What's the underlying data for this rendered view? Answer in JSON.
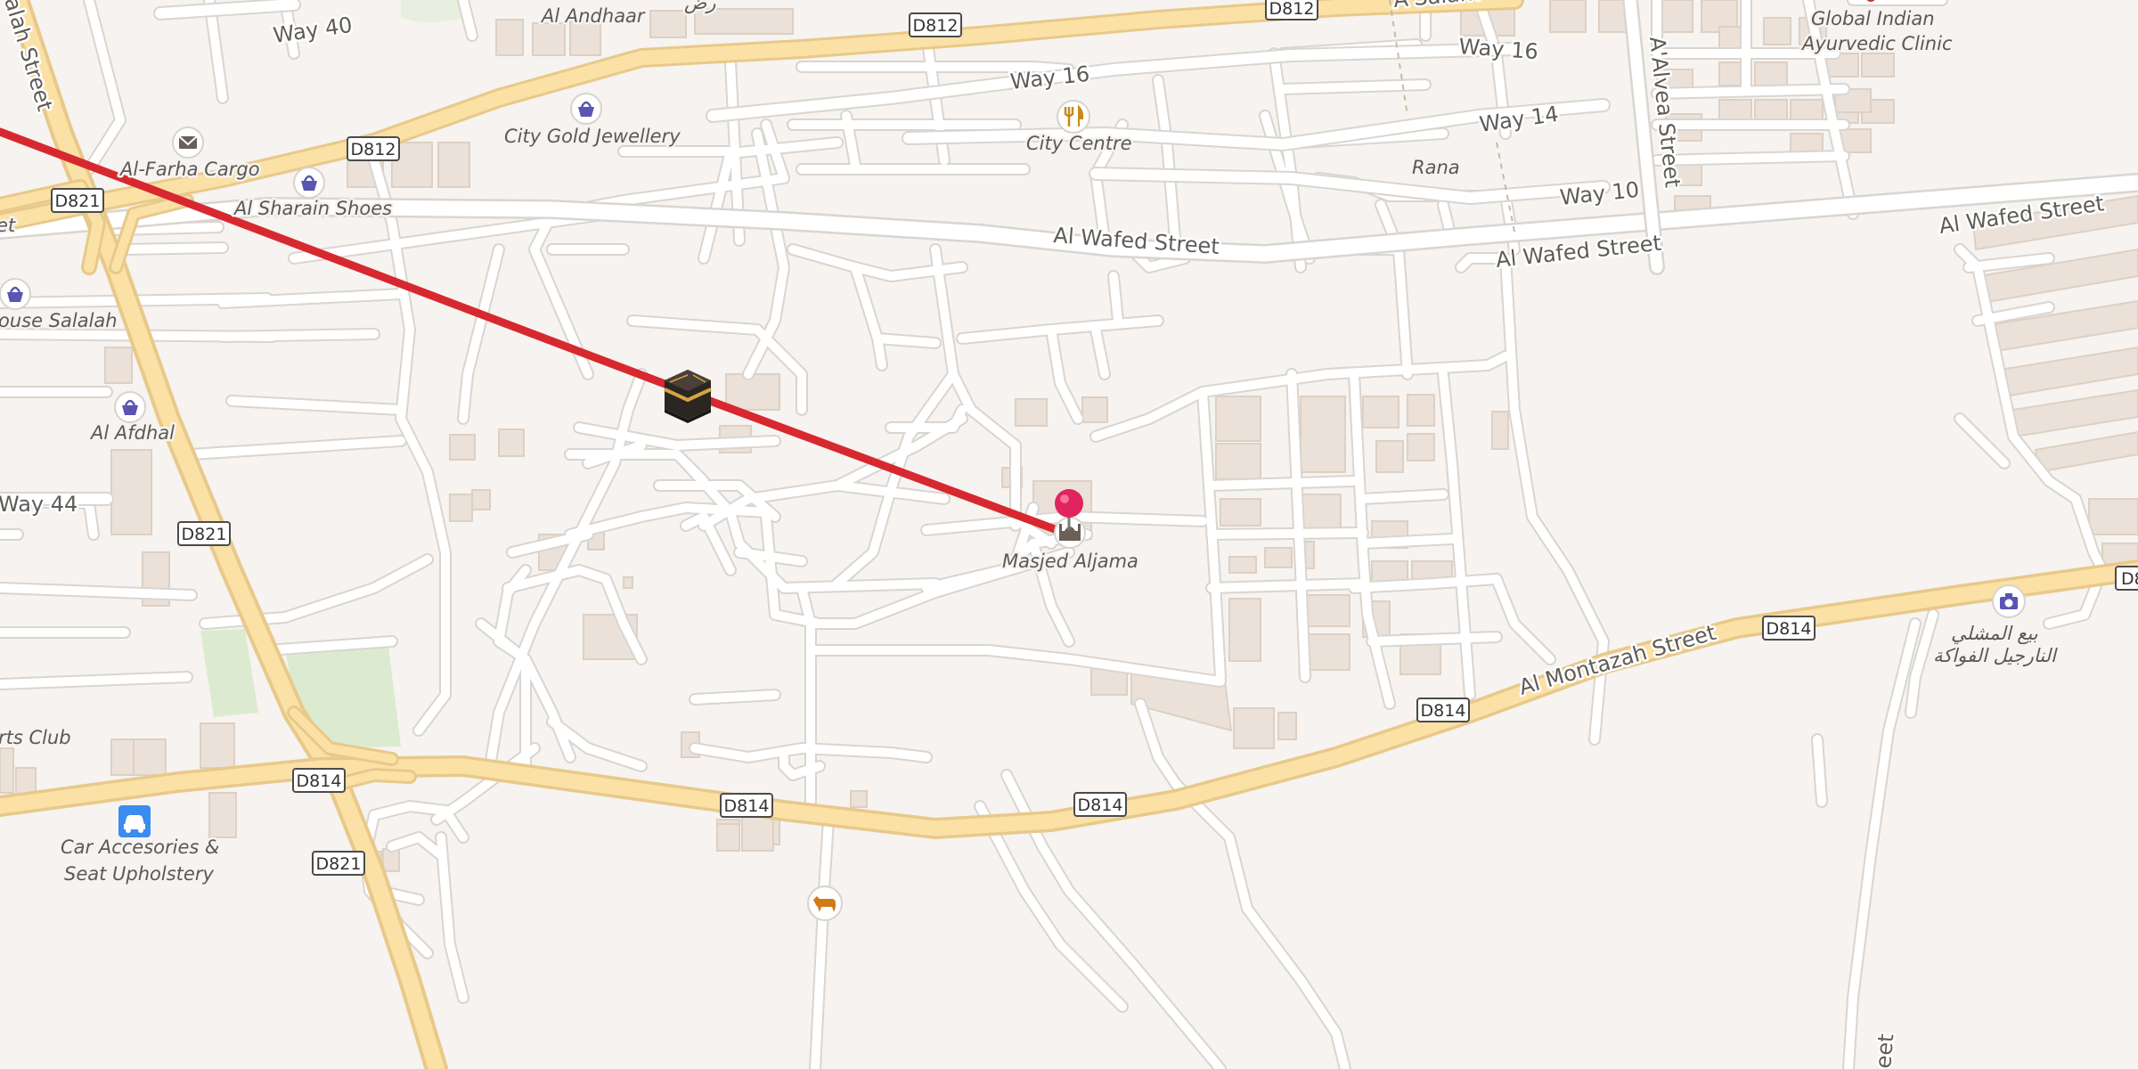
{
  "colors": {
    "background": "#f6f3f0",
    "road": "#ffffff",
    "major_road": "#fbe1a6",
    "building": "#ebe1d8",
    "park": "#dcebcf",
    "route": "#d8282f",
    "pin": "#e0245e",
    "poi_shop": "#5a54b3",
    "poi_food": "#c88a1c",
    "poi_car": "#3b8cf0"
  },
  "streets": {
    "way_40": "Way 40",
    "way_16": "Way 16",
    "way_16_b": "Way 16",
    "way_14": "Way 14",
    "way_10": "Way 10",
    "way_44": "Way 44",
    "al_wafed_1": "Al Wafed Street",
    "al_wafed_2": "Al Wafed Street",
    "al_wafed_3": "Al Wafed Street",
    "al_montazah": "Al Montazah Street",
    "alvea": "A'Alvea Street",
    "salalah_street": "alah Street",
    "a_salam": "A'Salam",
    "rana": "Rana",
    "street_edge": "eet"
  },
  "shields": {
    "d812_a": "D812",
    "d812_b": "D812",
    "d812_c": "D812",
    "d821_a": "D821",
    "d821_b": "D821",
    "d821_c": "D821",
    "d814_a": "D814",
    "d814_b": "D814",
    "d814_c": "D814",
    "d814_d": "D814",
    "d814_e": "D814",
    "d8_edge": "D8"
  },
  "places": {
    "al_andhaar": "Al Andhaar",
    "arabic_top": "رض",
    "city_gold": "City Gold Jewellery",
    "city_centre": "City Centre",
    "al_farha": "Al-Farha Cargo",
    "al_sharain": "Al Sharain Shoes",
    "house_salalah": "ouse Salalah",
    "al_afdhal": "Al Afdhal",
    "global_indian_1": "Global Indian",
    "global_indian_2": "Ayurvedic Clinic",
    "masjed": "Masjed Aljama",
    "sports_club": "rts Club",
    "car_acc_1": "Car Accesories &",
    "car_acc_2": "Seat Upholstery",
    "arabic_shop_1": "بيع المشلي",
    "arabic_shop_2": "النارجيل الفواكة",
    "left_edge": "et"
  },
  "icons": {
    "kaaba": "kaaba-icon",
    "pin": "location-pin-icon",
    "mosque": "mosque-icon",
    "shop": "shopping-basket-icon",
    "mail": "mail-icon",
    "food": "restaurant-icon",
    "car": "car-icon",
    "camera": "camera-icon",
    "cow": "cow-icon"
  }
}
